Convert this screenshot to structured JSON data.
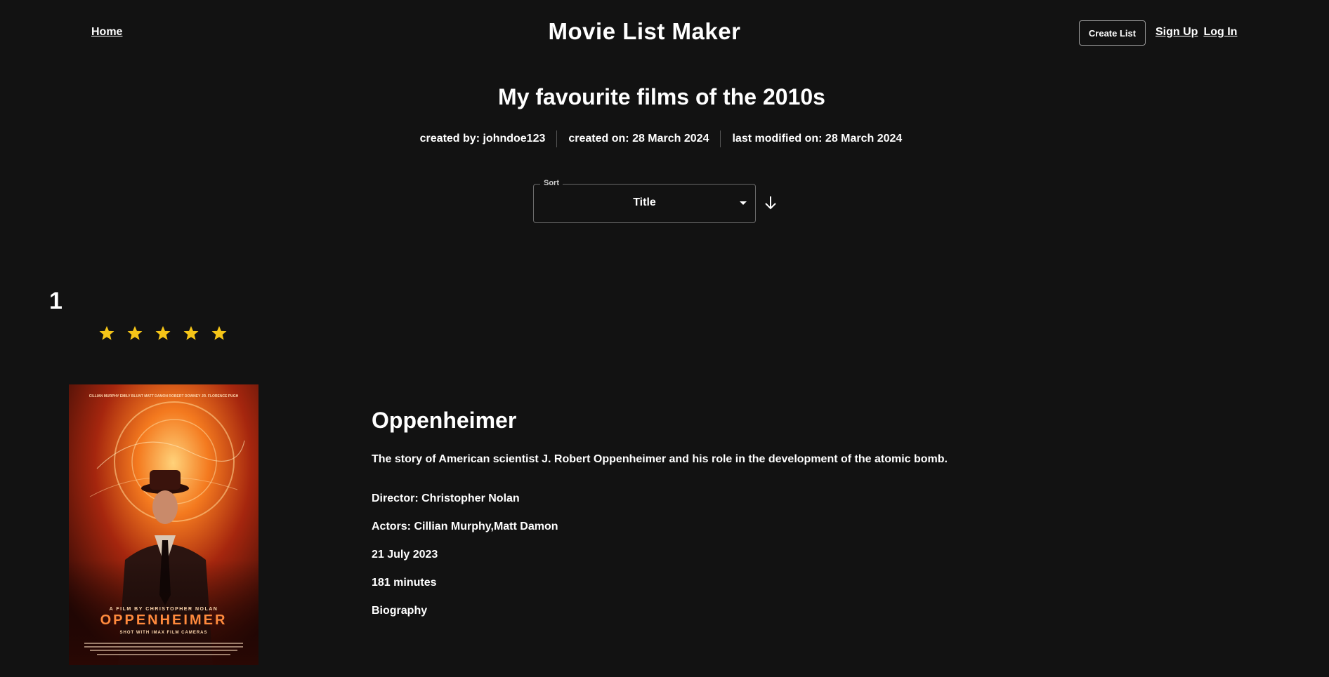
{
  "nav": {
    "home": "Home",
    "brand": "Movie List Maker",
    "create_list": "Create List",
    "sign_up": "Sign Up",
    "log_in": "Log In"
  },
  "list": {
    "title": "My favourite films of the 2010s",
    "created_by": "created by: johndoe123",
    "created_on": "created on: 28 March 2024",
    "last_modified": "last modified on: 28 March 2024"
  },
  "sort": {
    "label": "Sort",
    "value": "Title",
    "direction_icon": "arrow-down-icon"
  },
  "entries": [
    {
      "rank": "1",
      "rating": 5,
      "rating_max": 5,
      "poster_text": {
        "credits_top": "CILLIAN MURPHY   EMILY BLUNT   MATT DAMON   ROBERT DOWNEY JR.   FLORENCE PUGH",
        "byline": "A FILM BY CHRISTOPHER NOLAN",
        "title": "OPPENHEIMER",
        "format": "SHOT WITH IMAX FILM CAMERAS"
      },
      "title": "Oppenheimer",
      "description": "The story of American scientist J. Robert Oppenheimer and his role in the development of the atomic bomb.",
      "director": "Director: Christopher Nolan",
      "actors": "Actors: Cillian Murphy,Matt Damon",
      "release_date": "21 July 2023",
      "runtime": "181 minutes",
      "genre": "Biography"
    }
  ],
  "colors": {
    "background": "#121212",
    "text": "#ffffff",
    "star": "#f5c518"
  }
}
